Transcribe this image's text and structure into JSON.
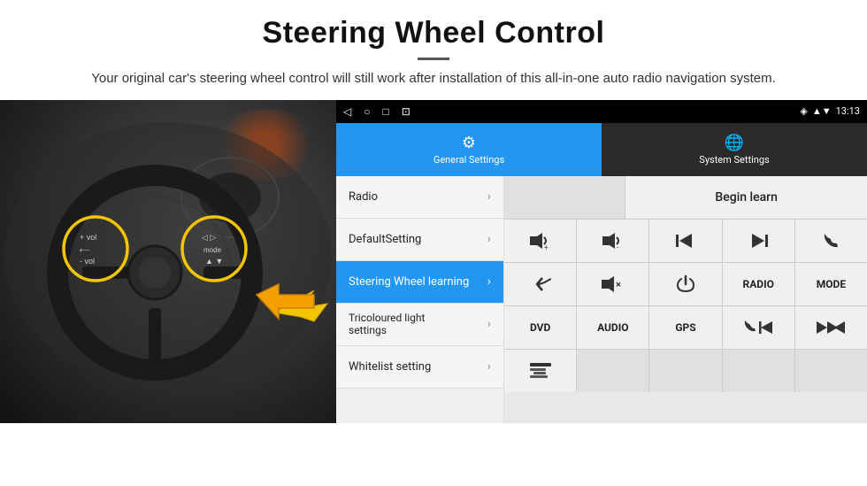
{
  "header": {
    "title": "Steering Wheel Control",
    "description": "Your original car's steering wheel control will still work after installation of this all-in-one auto radio navigation system."
  },
  "status_bar": {
    "icons_left": [
      "◁",
      "○",
      "□",
      "⊡"
    ],
    "signal": "▲▼",
    "wifi": "♦",
    "time": "13:13"
  },
  "tabs": [
    {
      "id": "general",
      "icon": "⚙",
      "label": "General Settings",
      "active": true
    },
    {
      "id": "system",
      "icon": "🌐",
      "label": "System Settings",
      "active": false
    }
  ],
  "menu_items": [
    {
      "id": "radio",
      "label": "Radio",
      "active": false
    },
    {
      "id": "default",
      "label": "DefaultSetting",
      "active": false
    },
    {
      "id": "steering",
      "label": "Steering Wheel learning",
      "active": true
    },
    {
      "id": "tricoloured",
      "label": "Tricoloured light settings",
      "active": false
    },
    {
      "id": "whitelist",
      "label": "Whitelist setting",
      "active": false
    }
  ],
  "controls": {
    "begin_learn_label": "Begin learn",
    "buttons": {
      "row2": [
        "vol+",
        "vol-",
        "prev",
        "next",
        "phone"
      ],
      "row3": [
        "back",
        "mute",
        "power",
        "radio_btn",
        "mode"
      ],
      "row4": [
        "dvd",
        "audio",
        "gps",
        "phone_prev",
        "ff_rew"
      ],
      "row5": [
        "list_icon"
      ]
    },
    "labels": {
      "vol_up": "🔊+",
      "vol_down": "🔉-",
      "prev": "⏮",
      "next": "⏭",
      "phone_answer": "📞",
      "back": "↩",
      "mute": "🔇×",
      "power": "⏻",
      "radio": "RADIO",
      "mode": "MODE",
      "dvd": "DVD",
      "audio": "AUDIO",
      "gps": "GPS",
      "phone_prev": "📞⏮",
      "ff_rew": "⏪⏩",
      "list": "≡"
    }
  }
}
